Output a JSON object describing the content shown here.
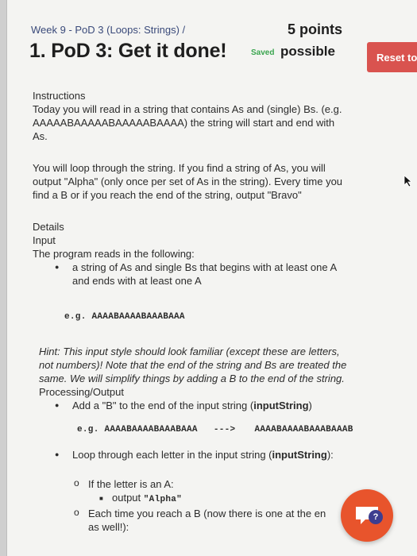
{
  "header": {
    "breadcrumb": "Week 9 - PoD 3 (Loops: Strings) /",
    "title": "1. PoD 3: Get it done!",
    "points": "5 points",
    "saved": "Saved",
    "possible": "possible",
    "reset_label": "Reset to St"
  },
  "instructions": {
    "heading": "Instructions",
    "line1": "Today you will read in a string that contains As and (single) Bs. (e.g.",
    "line2": "AAAAABAAAAABAAAAABAAAA) the string will start and end with",
    "line3": "As.",
    "para2_line1": "You will loop through the string. If you find a string of As, you will",
    "para2_line2": "output \"Alpha\" (only once per set of As in the string). Every time you",
    "para2_line3": "find a B or if you reach the end of the string, output \"Bravo\""
  },
  "details": {
    "heading": "Details",
    "input_heading": "Input",
    "input_intro": "The program reads in the following:",
    "input_bullet_line1": "a string of As and single Bs that begins with at least one A",
    "input_bullet_line2": "and ends with at least one A",
    "example1": "e.g. AAAABAAAABAAABAAA",
    "hint_line1": "Hint: This input style should look familiar (except these are letters,",
    "hint_line2": "not numbers)! Note that the end of the string and Bs are treated the",
    "hint_line3": "same. We will simplify things by adding a B to the end of the string.",
    "processing_heading": "Processing/Output",
    "proc_bullet1_text": "Add a \"B\" to the end of the input string (",
    "proc_bullet1_bold": "inputString",
    "proc_bullet1_end": ")",
    "example2_left": "e.g. AAAABAAAABAAABAAA",
    "example2_arrow": "--->",
    "example2_right": "AAAABAAAABAAABAAAB",
    "proc_bullet2_text": "Loop through each letter in the input string (",
    "proc_bullet2_bold": "inputString",
    "proc_bullet2_end": "):",
    "sub1": "If the letter is an A:",
    "sub1_output_prefix": "output ",
    "sub1_output_code": "\"Alpha\"",
    "sub2_line1": "Each time you reach a B (now there is one at the en",
    "sub2_line2": "as well!):"
  },
  "help": {
    "badge": "?",
    "icon": "chat-help-icon",
    "color": "#e8542c"
  }
}
